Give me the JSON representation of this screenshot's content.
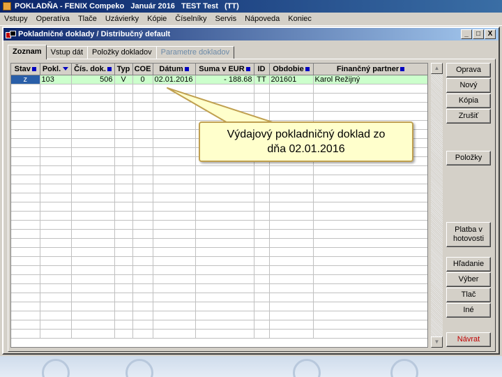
{
  "app": {
    "title_parts": [
      "POKLADŇA - FENIX Compeko",
      "Január 2016",
      "TEST Test",
      "(TT)"
    ]
  },
  "menu": [
    "Vstupy",
    "Operatíva",
    "Tlače",
    "Uzávierky",
    "Kópie",
    "Číselníky",
    "Servis",
    "Nápoveda",
    "Koniec"
  ],
  "window": {
    "title": "Pokladničné doklady / Distribučný default",
    "controls": [
      "_",
      "□",
      "X"
    ]
  },
  "tabs": [
    {
      "label": "Zoznam",
      "state": "active"
    },
    {
      "label": "Vstup dát",
      "state": "normal"
    },
    {
      "label": "Položky dokladov",
      "state": "normal"
    },
    {
      "label": "Parametre dokladov",
      "state": "disabled"
    }
  ],
  "grid": {
    "columns": [
      "Stav",
      "Pokl.",
      "Čís. dok.",
      "Typ",
      "COE",
      "Dátum",
      "Suma v EUR",
      "ID",
      "Obdobie",
      "Finančný partner"
    ],
    "rows": [
      [
        "z",
        "103",
        "506",
        "V",
        "0",
        "02.01.2016",
        "- 188.68",
        "TT",
        "201601",
        "Karol Režijný"
      ]
    ]
  },
  "buttons": {
    "oprava": "Oprava",
    "novy": "Nový",
    "kopia": "Kópia",
    "zrusit": "Zrušiť",
    "polozky": "Položky",
    "platba_line1": "Platba v",
    "platba_line2": "hotovosti",
    "hladanie": "Hľadanie",
    "vyber": "Výber",
    "tlac": "Tlač",
    "ine": "Iné",
    "navrat": "Návrat"
  },
  "callout": {
    "line1": "Výdajový pokladničný doklad zo",
    "line2": "dňa 02.01.2016"
  },
  "colors": {
    "selected_row": "#ccffcc",
    "selected_cell": "#2a5fa8",
    "callout_bg": "#ffffcc",
    "title_bar": "#0a246a"
  }
}
